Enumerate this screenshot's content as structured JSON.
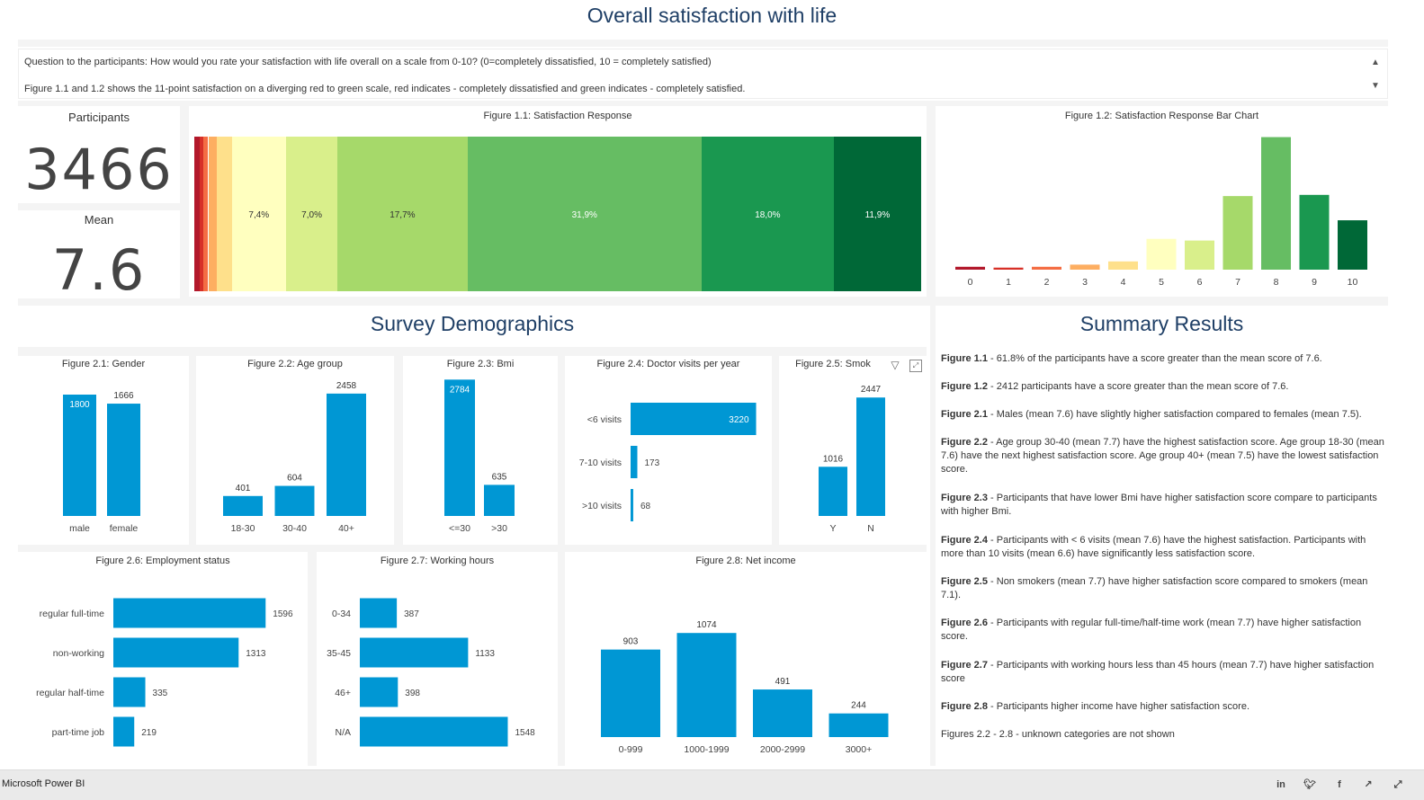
{
  "page": {
    "title": "Overall satisfaction with life",
    "intro_line1": "Question to the participants: How would you rate your satisfaction with life overall on a scale from 0-10? (0=completely dissatisfied,  10 = completely satisfied)",
    "intro_line2": "Figure 1.1 and 1.2 shows the 11-point satisfaction on a diverging red to green scale, red indicates - completely dissatisfied and green indicates - completely satisfied."
  },
  "kpi": {
    "participants_label": "Participants",
    "participants_value": "3466",
    "mean_label": "Mean",
    "mean_value": "7.6"
  },
  "fig11": {
    "title": "Figure 1.1: Satisfaction Response",
    "segments": [
      {
        "score": 0,
        "pct": 0.7,
        "color": "#b2182b",
        "label": ""
      },
      {
        "score": 1,
        "pct": 0.5,
        "color": "#d73027",
        "label": ""
      },
      {
        "score": 2,
        "pct": 0.7,
        "color": "#f46d43",
        "label": ""
      },
      {
        "score": 3,
        "pct": 1.2,
        "color": "#fdae61",
        "label": ""
      },
      {
        "score": 4,
        "pct": 2.0,
        "color": "#fee08b",
        "label": ""
      },
      {
        "score": 5,
        "pct": 7.4,
        "color": "#ffffbf",
        "label": "7,4%"
      },
      {
        "score": 6,
        "pct": 7.0,
        "color": "#d9ef8b",
        "label": "7,0%"
      },
      {
        "score": 7,
        "pct": 17.7,
        "color": "#a6d96a",
        "label": "17,7%"
      },
      {
        "score": 8,
        "pct": 31.9,
        "color": "#66bd63",
        "label": "31,9%"
      },
      {
        "score": 9,
        "pct": 18.0,
        "color": "#1a9850",
        "label": "18,0%"
      },
      {
        "score": 10,
        "pct": 11.9,
        "color": "#006837",
        "label": "11,9%"
      }
    ]
  },
  "sections": {
    "demographics": "Survey Demographics",
    "summary": "Summary Results"
  },
  "summary": {
    "items": [
      {
        "fig": "Figure 1.1",
        "text": " - 61.8% of the participants have a score greater than the mean score of 7.6."
      },
      {
        "fig": "Figure 1.2",
        "text": " - 2412 participants have a score greater than the mean score of 7.6."
      },
      {
        "fig": "Figure 2.1",
        "text": " - Males (mean 7.6) have slightly higher satisfaction compared to females (mean 7.5)."
      },
      {
        "fig": "Figure 2.2",
        "text": " - Age group 30-40 (mean 7.7) have the highest satisfaction score. Age group 18-30 (mean 7.6) have the next highest satisfaction score. Age group 40+ (mean 7.5) have the lowest satisfaction score."
      },
      {
        "fig": "Figure 2.3",
        "text": " - Participants that have lower Bmi have higher satisfaction score compare to participants with higher Bmi."
      },
      {
        "fig": "Figure 2.4",
        "text": " - Participants with < 6 visits (mean 7.6) have the highest satisfaction. Participants with more than 10 visits  (mean 6.6) have significantly less satisfaction score."
      },
      {
        "fig": "Figure 2.5",
        "text": " - Non smokers (mean 7.7) have higher satisfaction score compared to smokers (mean 7.1)."
      },
      {
        "fig": "Figure 2.6",
        "text": " - Participants with regular full-time/half-time work  (mean 7.7) have higher satisfaction score."
      },
      {
        "fig": "Figure 2.7",
        "text": " - Participants with working hours less than 45 hours (mean 7.7) have higher satisfaction score"
      },
      {
        "fig": "Figure 2.8",
        "text": " - Participants higher income have higher satisfaction score."
      }
    ],
    "footnote": "Figures 2.2 - 2.8 - unknown categories are not shown"
  },
  "footer": {
    "brand": "Microsoft Power BI"
  },
  "colors": {
    "bar": "#0097d4",
    "title": "#1f3f66"
  },
  "chart_data": [
    {
      "id": "fig12",
      "type": "bar",
      "title": "Figure 1.2: Satisfaction Response Bar Chart",
      "categories": [
        "0",
        "1",
        "2",
        "3",
        "4",
        "5",
        "6",
        "7",
        "8",
        "9",
        "10"
      ],
      "values": [
        24,
        17,
        24,
        42,
        69,
        257,
        243,
        614,
        1106,
        624,
        412
      ],
      "colors": [
        "#b2182b",
        "#d73027",
        "#f46d43",
        "#fdae61",
        "#fee08b",
        "#ffffbf",
        "#d9ef8b",
        "#a6d96a",
        "#66bd63",
        "#1a9850",
        "#006837"
      ],
      "ylim": [
        0,
        1200
      ]
    },
    {
      "id": "fig21",
      "type": "bar",
      "title": "Figure 2.1: Gender",
      "categories": [
        "male",
        "female"
      ],
      "values": [
        1800,
        1666
      ],
      "ylim": [
        0,
        2000
      ]
    },
    {
      "id": "fig22",
      "type": "bar",
      "title": "Figure 2.2: Age group",
      "categories": [
        "18-30",
        "30-40",
        "40+"
      ],
      "values": [
        401,
        604,
        2458
      ],
      "ylim": [
        0,
        2600
      ]
    },
    {
      "id": "fig23",
      "type": "bar",
      "title": "Figure 2.3: Bmi",
      "categories": [
        "<=30",
        ">30"
      ],
      "values": [
        2784,
        635
      ],
      "ylim": [
        0,
        2900
      ]
    },
    {
      "id": "fig24",
      "type": "bar",
      "orientation": "horizontal",
      "title": "Figure 2.4: Doctor visits per year",
      "categories": [
        "<6 visits",
        "7-10 visits",
        ">10 visits"
      ],
      "values": [
        3220,
        173,
        68
      ],
      "xlim": [
        0,
        3300
      ]
    },
    {
      "id": "fig25",
      "type": "bar",
      "title": "Figure 2.5: Smok",
      "categories": [
        "Y",
        "N"
      ],
      "values": [
        1016,
        2447
      ],
      "ylim": [
        0,
        2600
      ]
    },
    {
      "id": "fig26",
      "type": "bar",
      "orientation": "horizontal",
      "title": "Figure 2.6: Employment status",
      "categories": [
        "regular full-time",
        "non-working",
        "regular half-time",
        "part-time job"
      ],
      "values": [
        1596,
        1313,
        335,
        219
      ],
      "xlim": [
        0,
        1650
      ]
    },
    {
      "id": "fig27",
      "type": "bar",
      "orientation": "horizontal",
      "title": "Figure 2.7: Working hours",
      "categories": [
        "0-34",
        "35-45",
        "46+",
        "N/A"
      ],
      "values": [
        387,
        1133,
        398,
        1548
      ],
      "xlim": [
        0,
        1600
      ]
    },
    {
      "id": "fig28",
      "type": "bar",
      "title": "Figure 2.8: Net income",
      "categories": [
        "0-999",
        "1000-1999",
        "2000-2999",
        "3000+"
      ],
      "values": [
        903,
        1074,
        491,
        244
      ],
      "ylim": [
        0,
        1150
      ]
    }
  ]
}
